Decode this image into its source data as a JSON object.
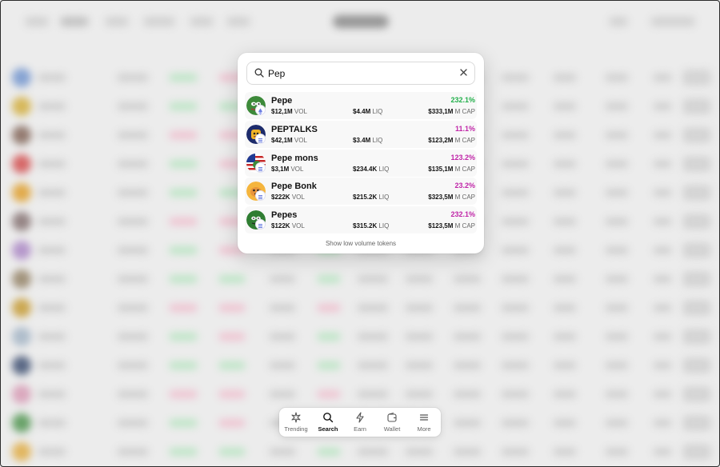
{
  "search": {
    "value": "Pep",
    "clear_icon": "close-icon",
    "search_icon": "search-icon"
  },
  "colors": {
    "positive": "#1fa34a",
    "highlight": "#c026a8"
  },
  "results": [
    {
      "name": "Pepe",
      "vol": "$12,1M",
      "vol_unit": "VOL",
      "liq": "$4.4M",
      "liq_unit": "LIQ",
      "change": "232.1%",
      "change_color": "#22b04b",
      "mcap": "$333,1M",
      "mcap_unit": "M CAP",
      "chain_icon": "ethereum-icon",
      "logo_icon": "pepe-frog-icon"
    },
    {
      "name": "PEPTALKS",
      "vol": "$42,1M",
      "vol_unit": "VOL",
      "liq": "$3.4M",
      "liq_unit": "LIQ",
      "change": "11.1%",
      "change_color": "#c026a8",
      "mcap": "$123,2M",
      "mcap_unit": "M CAP",
      "chain_icon": "solana-icon",
      "logo_icon": "peptalks-icon"
    },
    {
      "name": "Pepe mons",
      "vol": "$3,1M",
      "vol_unit": "VOL",
      "liq": "$234.4K",
      "liq_unit": "LIQ",
      "change": "123.2%",
      "change_color": "#c026a8",
      "mcap": "$135,1M",
      "mcap_unit": "M CAP",
      "chain_icon": "solana-icon",
      "logo_icon": "pepe-mons-icon"
    },
    {
      "name": "Pepe Bonk",
      "vol": "$222K",
      "vol_unit": "VOL",
      "liq": "$215.2K",
      "liq_unit": "LIQ",
      "change": "23.2%",
      "change_color": "#c026a8",
      "mcap": "$323,5M",
      "mcap_unit": "M CAP",
      "chain_icon": "solana-icon",
      "logo_icon": "pepe-bonk-icon"
    },
    {
      "name": "Pepes",
      "vol": "$122K",
      "vol_unit": "VOL",
      "liq": "$315.2K",
      "liq_unit": "LIQ",
      "change": "232.1%",
      "change_color": "#c026a8",
      "mcap": "$123,5M",
      "mcap_unit": "M CAP",
      "chain_icon": "solana-icon",
      "logo_icon": "pepes-frog-icon"
    }
  ],
  "footer_link": "Show low volume tokens",
  "nav": [
    {
      "label": "Trending",
      "icon": "trending-icon",
      "active": false
    },
    {
      "label": "Search",
      "icon": "search-icon",
      "active": true
    },
    {
      "label": "Earn",
      "icon": "lightning-icon",
      "active": false
    },
    {
      "label": "Wallet",
      "icon": "wallet-icon",
      "active": false
    },
    {
      "label": "More",
      "icon": "menu-icon",
      "active": false
    }
  ]
}
